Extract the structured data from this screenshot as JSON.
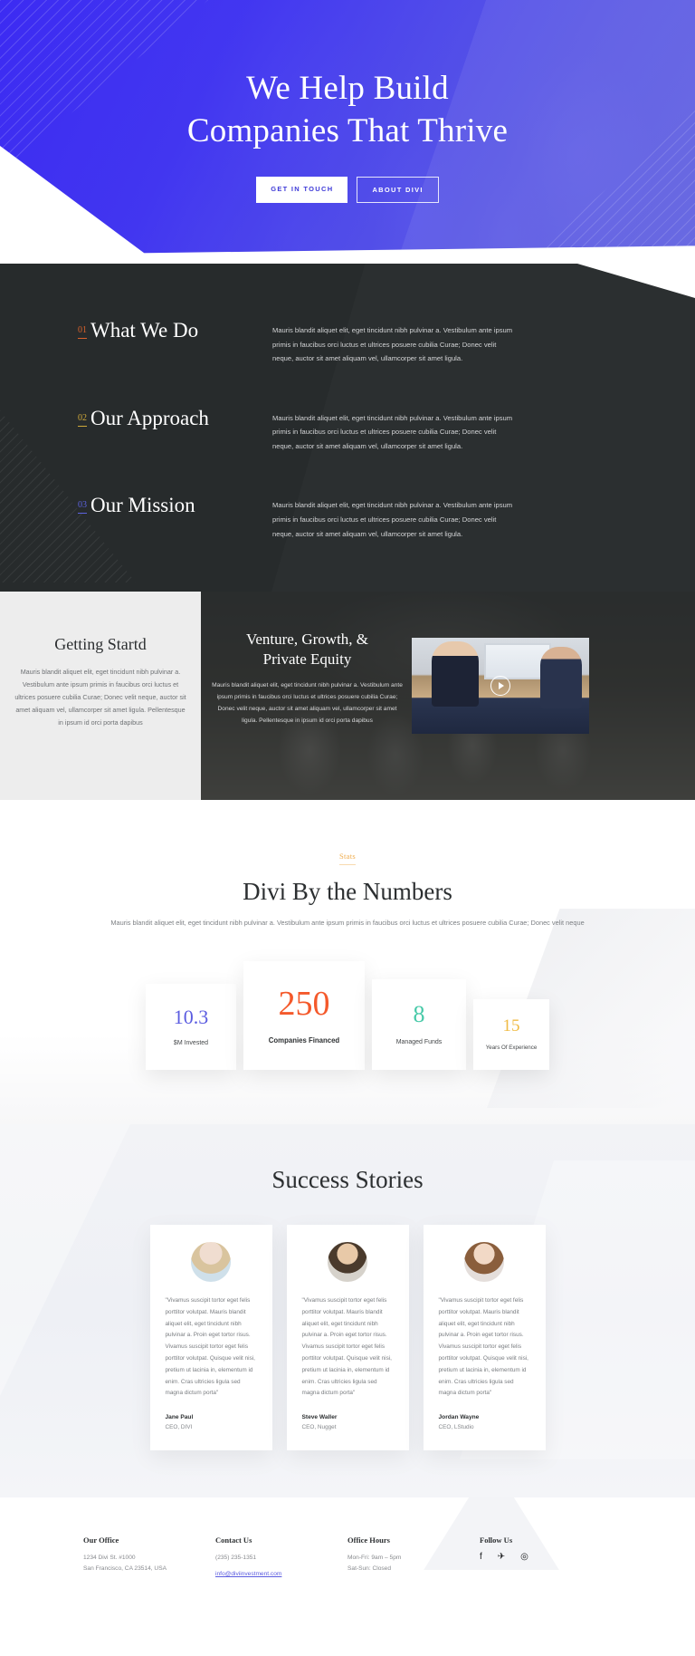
{
  "hero": {
    "title_line1": "We Help Build",
    "title_line2": "Companies That Thrive",
    "btn_primary": "GET IN TOUCH",
    "btn_secondary": "ABOUT DIVI",
    "accent": "#3623f5"
  },
  "dark_section": {
    "rows": [
      {
        "num": "01",
        "num_color": "#d9622b",
        "title": "What We Do",
        "body": "Mauris blandit aliquet elit, eget tincidunt nibh pulvinar a. Vestibulum ante ipsum primis in faucibus orci luctus et ultrices posuere cubilia Curae; Donec velit neque, auctor sit amet aliquam vel, ullamcorper sit amet ligula."
      },
      {
        "num": "02",
        "num_color": "#d0a93a",
        "title": "Our Approach",
        "body": "Mauris blandit aliquet elit, eget tincidunt nibh pulvinar a. Vestibulum ante ipsum primis in faucibus orci luctus et ultrices posuere cubilia Curae; Donec velit neque, auctor sit amet aliquam vel, ullamcorper sit amet ligula."
      },
      {
        "num": "03",
        "num_color": "#5c63e0",
        "title": "Our Mission",
        "body": "Mauris blandit aliquet elit, eget tincidunt nibh pulvinar a. Vestibulum ante ipsum primis in faucibus orci luctus et ultrices posuere cubilia Curae; Donec velit neque, auctor sit amet aliquam vel, ullamcorper sit amet ligula."
      }
    ]
  },
  "getting_started": {
    "title": "Getting Startd",
    "body": "Mauris blandit aliquet elit, eget tincidunt nibh pulvinar a. Vestibulum ante ipsum primis in faucibus orci luctus et ultrices posuere cubilia Curae; Donec velit neque, auctor sit amet aliquam vel, ullamcorper sit amet ligula. Pellentesque in ipsum id orci porta dapibus"
  },
  "venture": {
    "title_line1": "Venture, Growth, &",
    "title_line2": "Private Equity",
    "body": "Mauris blandit aliquet elit, eget tincidunt nibh pulvinar a. Vestibulum ante ipsum primis in faucibus orci luctus et ultrices posuere cubilia Curae; Donec velit neque, auctor sit amet aliquam vel, ullamcorper sit amet ligula. Pellentesque in ipsum id orci porta dapibus",
    "play_label": "play-button"
  },
  "stats": {
    "eyebrow": "Stats",
    "title": "Divi By the Numbers",
    "subtitle": "Mauris blandit aliquet elit, eget tincidunt nibh pulvinar a. Vestibulum ante ipsum primis in faucibus orci luctus et ultrices posuere cubilia Curae; Donec velit neque",
    "cards": [
      {
        "value": "10.3",
        "label": "$M Invested",
        "color": "#5b5ce0"
      },
      {
        "value": "250",
        "label": "Companies Financed",
        "color": "#f4592b"
      },
      {
        "value": "8",
        "label": "Managed Funds",
        "color": "#47c9a8"
      },
      {
        "value": "15",
        "label": "Years Of Experience",
        "color": "#f0bb45"
      }
    ]
  },
  "chart_data": {
    "type": "bar",
    "title": "Divi By the Numbers",
    "categories": [
      "$M Invested",
      "Companies Financed",
      "Managed Funds",
      "Years Of Experience"
    ],
    "values": [
      10.3,
      250,
      8,
      15
    ],
    "colors": [
      "#5b5ce0",
      "#f4592b",
      "#47c9a8",
      "#f0bb45"
    ],
    "xlabel": "",
    "ylabel": "",
    "grid": false,
    "legend": "none"
  },
  "testimonials": {
    "title": "Success Stories",
    "items": [
      {
        "quote": "\"Vivamus suscipit tortor eget felis porttitor volutpat. Mauris blandit aliquet elit, eget tincidunt nibh pulvinar a. Proin eget tortor risus. Vivamus suscipit tortor eget felis porttitor volutpat. Quisque velit nisi, pretium ut lacinia in, elementum id enim. Cras ultricies ligula sed magna dictum porta\"",
        "name": "Jane Paul",
        "role": "CEO, DIVI"
      },
      {
        "quote": "\"Vivamus suscipit tortor eget felis porttitor volutpat. Mauris blandit aliquet elit, eget tincidunt nibh pulvinar a. Proin eget tortor risus. Vivamus suscipit tortor eget felis porttitor volutpat. Quisque velit nisi, pretium ut lacinia in, elementum id enim. Cras ultricies ligula sed magna dictum porta\"",
        "name": "Steve Waller",
        "role": "CEO, Nugget"
      },
      {
        "quote": "\"Vivamus suscipit tortor eget felis porttitor volutpat. Mauris blandit aliquet elit, eget tincidunt nibh pulvinar a. Proin eget tortor risus. Vivamus suscipit tortor eget felis porttitor volutpat. Quisque velit nisi, pretium ut lacinia in, elementum id enim. Cras ultricies ligula sed magna dictum porta\"",
        "name": "Jordan Wayne",
        "role": "CEO, LStudio"
      }
    ]
  },
  "footer": {
    "office": {
      "title": "Our Office",
      "line1": "1234 Divi St. #1000",
      "line2": "San Francisco, CA 23514, USA"
    },
    "contact": {
      "title": "Contact Us",
      "phone": "(235) 235-1351",
      "email": "info@diviinvestment.com"
    },
    "hours": {
      "title": "Office Hours",
      "line1": "Mon-Fri: 9am – 5pm",
      "line2": "Sat-Sun: Closed"
    },
    "follow": {
      "title": "Follow Us",
      "facebook": "f",
      "twitter": "✈",
      "instagram": "◎"
    }
  }
}
